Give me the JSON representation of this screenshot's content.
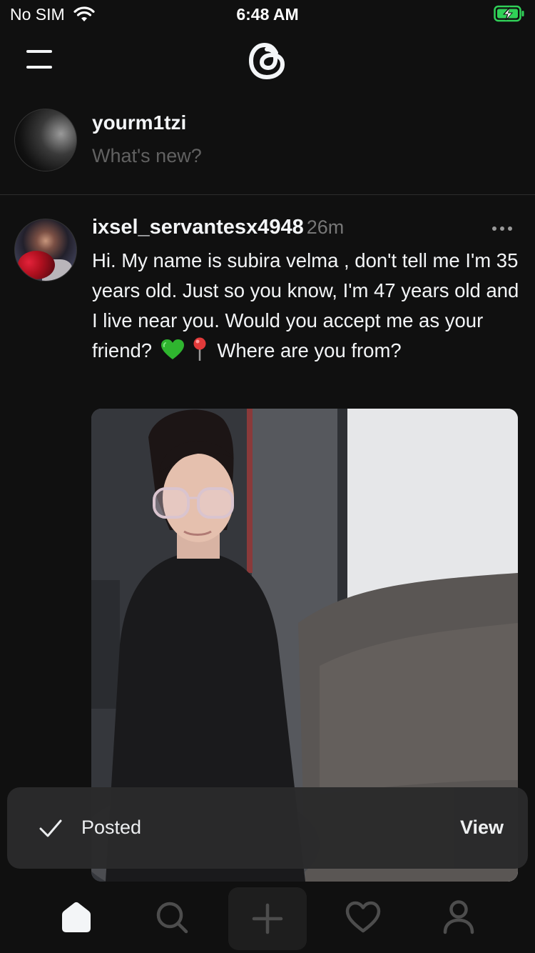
{
  "status_bar": {
    "carrier": "No SIM",
    "time": "6:48 AM",
    "battery_color": "#30d158"
  },
  "header": {
    "menu_icon": "menu-icon",
    "logo_icon": "threads-logo-icon"
  },
  "composer": {
    "username": "yourm1tzi",
    "placeholder": "What's new?"
  },
  "post": {
    "username": "ixsel_servantesx4948",
    "time": "26m",
    "text_part1": "Hi. My name is subira velma , don't tell me I'm 35 years old. Just so you know, I'm 47 years old and I live near you. Would you accept me as your friend?",
    "text_part2": "Where are you from?",
    "emojis": [
      "green-heart-icon",
      "round-pushpin-icon"
    ]
  },
  "toast": {
    "message": "Posted",
    "action": "View"
  },
  "tab_bar": {
    "tabs": [
      "home-icon",
      "search-icon",
      "compose-icon",
      "activity-icon",
      "profile-icon"
    ],
    "active": "home-icon"
  },
  "colors": {
    "background": "#101010",
    "text_primary": "#f3f5f7",
    "text_secondary": "#777777",
    "toast_bg": "#2a2a2b"
  }
}
